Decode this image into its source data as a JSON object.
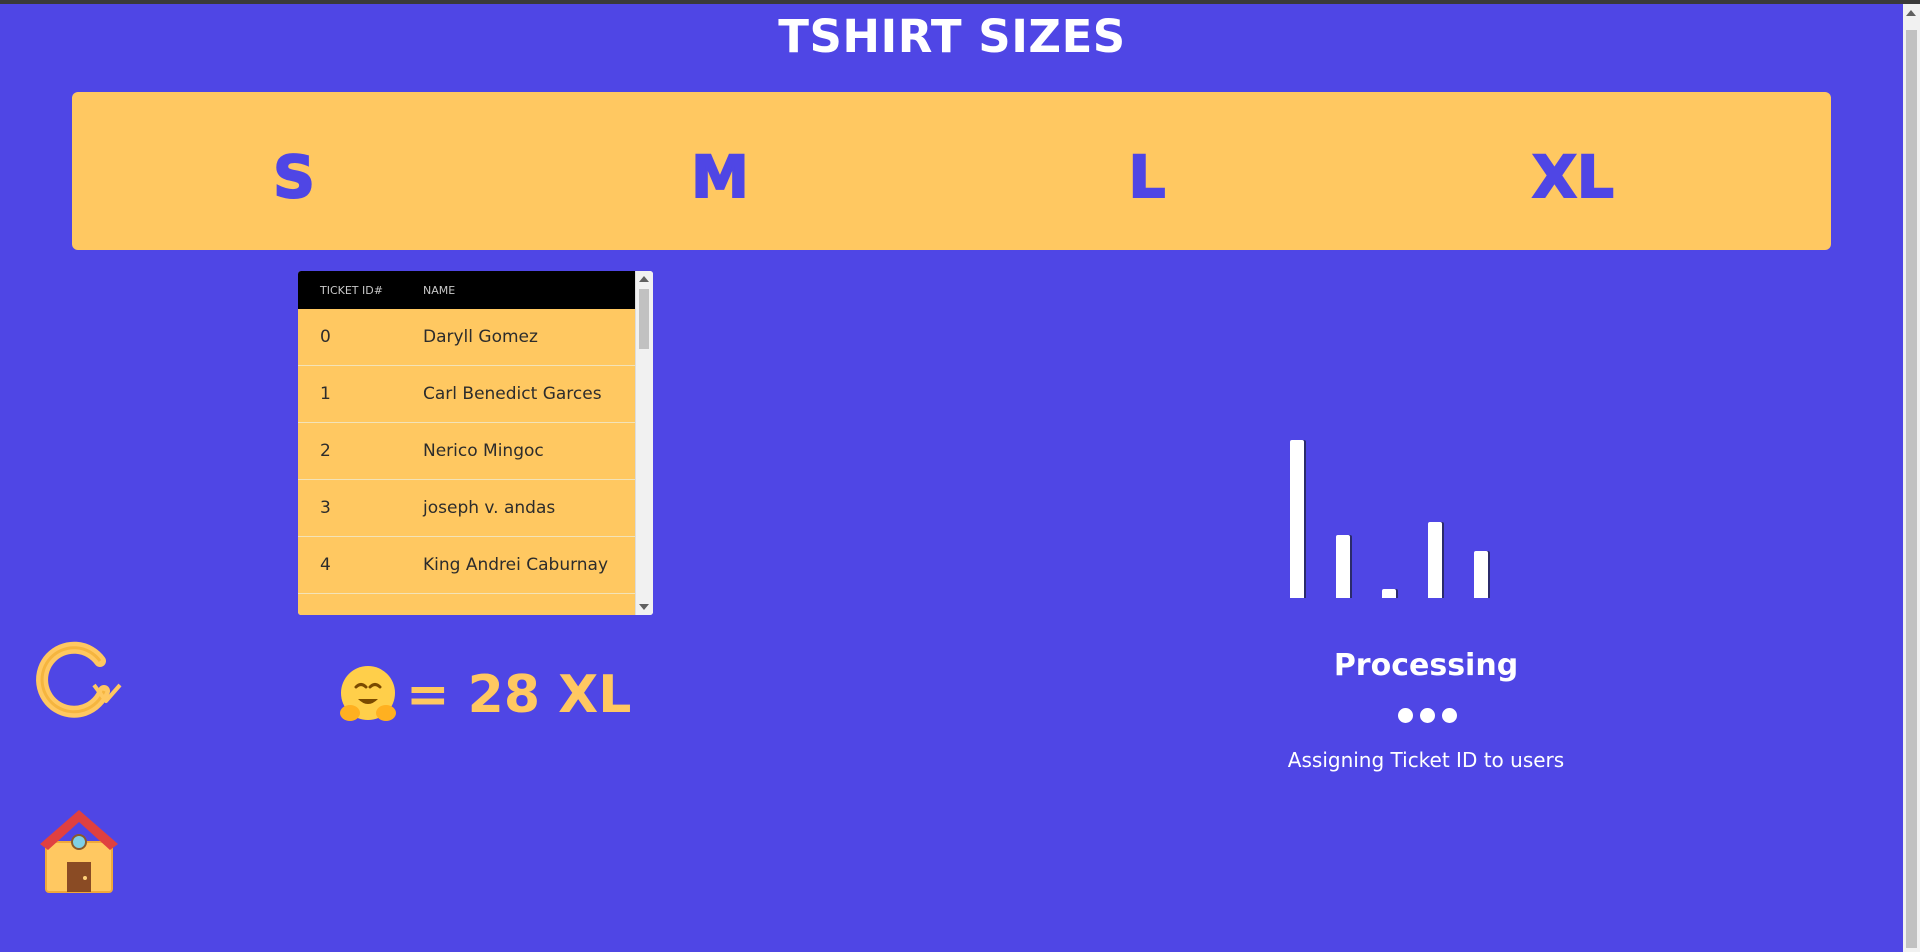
{
  "page": {
    "title": "TSHIRT SIZES",
    "background": "#4f46e5",
    "accent": "#ffc861"
  },
  "sizes": [
    {
      "label": "S"
    },
    {
      "label": "M"
    },
    {
      "label": "L"
    },
    {
      "label": "XL"
    }
  ],
  "ticket_table": {
    "headers": {
      "id": "TICKET ID#",
      "name": "NAME"
    },
    "rows": [
      {
        "id": "0",
        "name": "Daryll Gomez"
      },
      {
        "id": "1",
        "name": "Carl Benedict Garces"
      },
      {
        "id": "2",
        "name": "Nerico Mingoc"
      },
      {
        "id": "3",
        "name": "joseph v. andas"
      },
      {
        "id": "4",
        "name": "King Andrei Caburnay"
      }
    ]
  },
  "summary": {
    "icon": "hugging-face-emoji",
    "text": "= 28 XL"
  },
  "actions": {
    "refresh_icon": "refresh-icon",
    "home_icon": "house-icon"
  },
  "status": {
    "title": "Processing",
    "subtitle": "Assigning Ticket ID to users",
    "bar_levels": [
      1.0,
      0.4,
      0.06,
      0.48,
      0.3
    ]
  }
}
